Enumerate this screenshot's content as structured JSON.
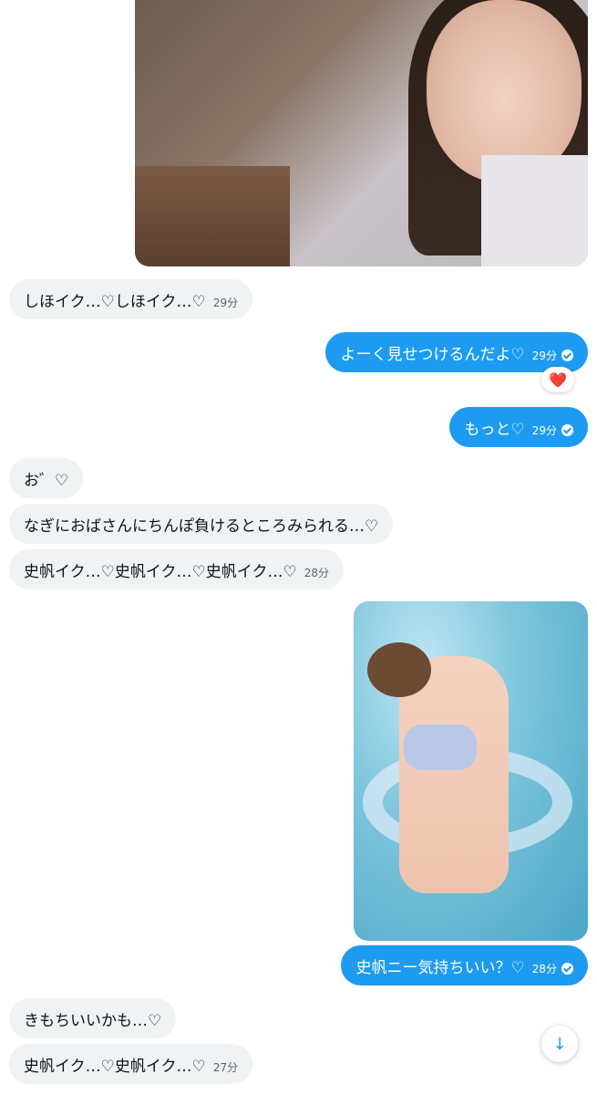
{
  "messages": [
    {
      "text": "しほイク…♡しほイク…♡",
      "time": "29分"
    },
    {
      "text": "よーく見せつけるんだよ♡",
      "time": "29分"
    },
    {
      "text": "もっと♡",
      "time": "29分"
    },
    {
      "text": "お゛♡"
    },
    {
      "text": "なぎにおばさんにちんぽ負けるところみられる…♡"
    },
    {
      "text": "史帆イク…♡史帆イク…♡史帆イク…♡",
      "time": "28分"
    },
    {
      "text": "史帆ニー気持ちいい？♡",
      "time": "28分"
    },
    {
      "text": "きもちいいかも…♡"
    },
    {
      "text": "史帆イク…♡史帆イク…♡",
      "time": "27分"
    }
  ],
  "reaction": {
    "emoji": "❤️"
  },
  "icons": {
    "read_receipt": "check-circle-icon",
    "scroll_down": "arrow-down-icon"
  },
  "colors": {
    "outgoing_bubble": "#1d9bf0",
    "incoming_bubble": "#eff3f4"
  }
}
